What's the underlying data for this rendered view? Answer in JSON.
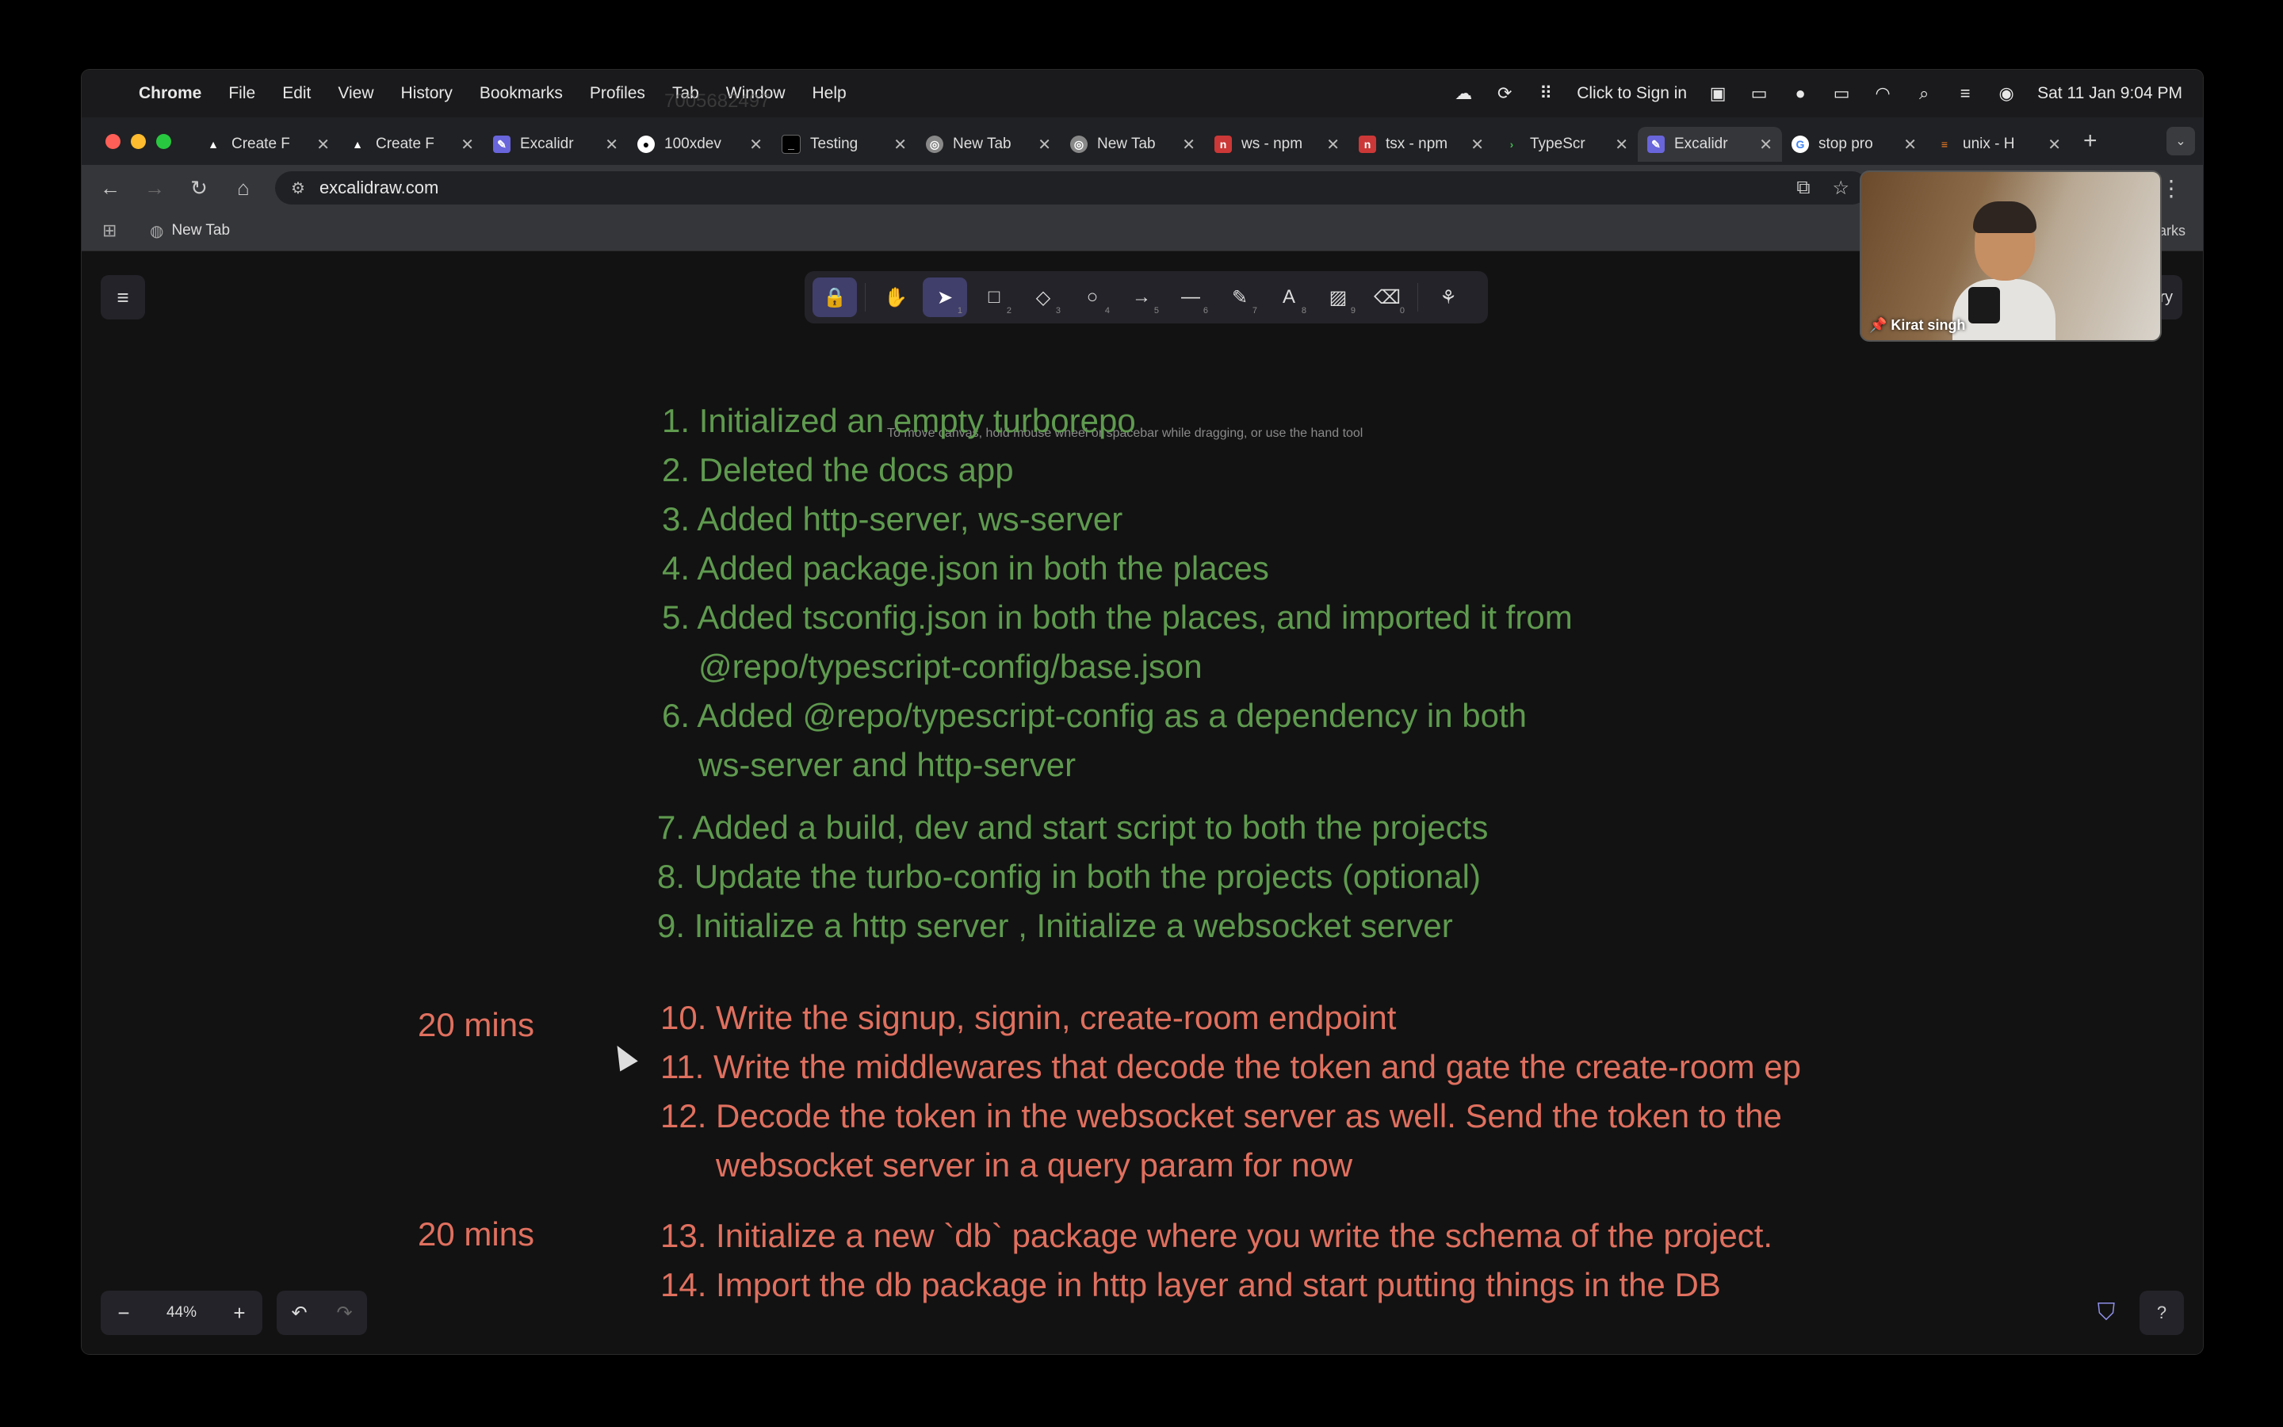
{
  "menubar": {
    "app": "Chrome",
    "items": [
      "File",
      "Edit",
      "View",
      "History",
      "Bookmarks",
      "Profiles",
      "Tab",
      "Window",
      "Help"
    ],
    "ghost_text": "7005682497",
    "sign_in": "Click to Sign in",
    "datetime": "Sat 11 Jan  9:04 PM"
  },
  "tabs": [
    {
      "title": "Create F",
      "icon": "vercel-icon"
    },
    {
      "title": "Create F",
      "icon": "vercel-icon"
    },
    {
      "title": "Excalidr",
      "icon": "excalidraw-icon"
    },
    {
      "title": "100xdev",
      "icon": "github-icon"
    },
    {
      "title": "Testing",
      "icon": "terminal-icon"
    },
    {
      "title": "New Tab",
      "icon": "chrome-icon"
    },
    {
      "title": "New Tab",
      "icon": "chrome-icon"
    },
    {
      "title": "ws - npm",
      "icon": "npm-icon"
    },
    {
      "title": "tsx - npm",
      "icon": "npm-icon"
    },
    {
      "title": "TypeScr",
      "icon": "typescript-icon"
    },
    {
      "title": "Excalidr",
      "icon": "excalidraw-icon",
      "active": true
    },
    {
      "title": "stop pro",
      "icon": "google-icon"
    },
    {
      "title": "unix - H",
      "icon": "stackoverflow-icon"
    }
  ],
  "address": {
    "url": "excalidraw.com"
  },
  "bookmarks": {
    "items": [
      "New Tab"
    ],
    "right_text": "arks"
  },
  "canvas": {
    "hint": "To move canvas, hold mouse wheel or spacebar while dragging, or use the hand tool",
    "zoom": "44%",
    "library_label": "ry",
    "steps_green": [
      "1. Initialized an empty turborepo",
      "2. Deleted the docs app",
      "3. Added http-server, ws-server",
      "4. Added package.json in both the places",
      "5. Added tsconfig.json in both the places, and imported it from",
      "@repo/typescript-config/base.json",
      "6. Added  @repo/typescript-config as a dependency in both",
      "ws-server and http-server",
      "7. Added a build, dev and start script to both the projects",
      "8. Update the turbo-config in both the projects (optional)",
      "9. Initialize a http server , Initialize a websocket server"
    ],
    "steps_red": [
      "10. Write the signup, signin, create-room endpoint",
      "11. Write the middlewares that decode the token and gate the create-room ep",
      "12. Decode the token in the websocket server as well. Send the token to the",
      "websocket server in a query param for now",
      "13. Initialize a new `db` package where you write the schema of the project.",
      "14. Import the db package in http layer and start putting things in the DB"
    ],
    "mins_1": "20 mins",
    "mins_2": "20 mins"
  },
  "video": {
    "name": "Kirat singh"
  },
  "colors": {
    "green_text": "#5f9a4f",
    "red_text": "#e0705f",
    "tool_active": "#403e6a"
  }
}
